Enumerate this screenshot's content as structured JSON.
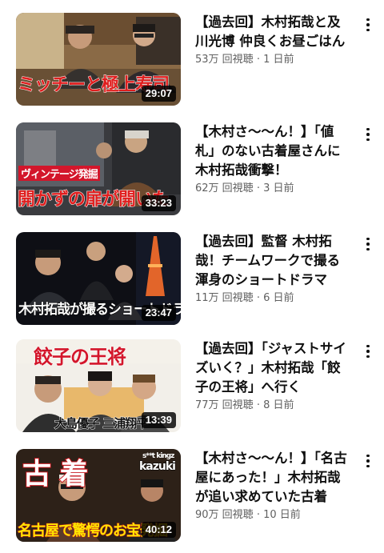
{
  "videos": [
    {
      "title": "【過去回】木村拓哉と及川光博 仲良くお昼ごはん",
      "views": "53万 回視聴",
      "age": "1 日前",
      "duration": "29:07",
      "caption": "ミッチーと極上寿司",
      "caption_color": "#e01e1e"
    },
    {
      "title": "【木村さ〜〜ん！】「値札」のない古着屋さんに木村拓哉衝撃！",
      "views": "62万 回視聴",
      "age": "3 日前",
      "duration": "33:23",
      "caption_small": "ヴィンテージ発掘",
      "caption": "開かずの扉が開いた",
      "caption_color": "#e01e1e"
    },
    {
      "title": "【過去回】監督 木村拓哉！チームワークで撮る渾身のショートドラマ",
      "views": "11万 回視聴",
      "age": "6 日前",
      "duration": "23:47",
      "caption": "木村拓哉が撮るショートドラマ",
      "caption_color": "#ffffff"
    },
    {
      "title": "【過去回】「ジャストサイズいく？」木村拓哉「餃子の王将」へ行く",
      "views": "77万 回視聴",
      "age": "8 日前",
      "duration": "13:39",
      "caption_top": "餃子の王将",
      "caption": "大島優子 三浦翔平",
      "caption_color": "#111111"
    },
    {
      "title": "【木村さ〜〜ん！】「名古屋にあった！」木村拓哉が追い求めていた古着",
      "views": "90万 回視聴",
      "age": "10 日前",
      "duration": "40:12",
      "caption_big": "古 着",
      "caption_tag": "kazuki",
      "caption_tag_small": "s**t kingz",
      "caption": "名古屋で驚愕のお宝発掘",
      "caption_color": "#ffe600"
    }
  ],
  "colors": {
    "title": "#0f0f0f",
    "meta": "#606060",
    "duration_bg": "#000000"
  },
  "icons": {
    "menu": "more-vertical-icon"
  }
}
